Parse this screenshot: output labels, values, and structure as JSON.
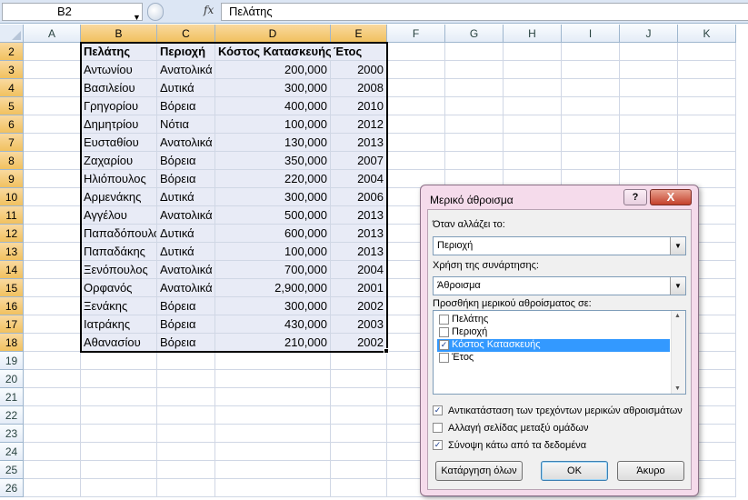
{
  "formula_bar": {
    "name_box": "B2",
    "fx_label": "fx",
    "formula_value": "Πελάτης"
  },
  "sheet": {
    "columns": [
      "A",
      "B",
      "C",
      "D",
      "E",
      "F",
      "G",
      "H",
      "I",
      "J",
      "K"
    ],
    "selected_columns": [
      "B",
      "C",
      "D",
      "E"
    ],
    "rows": [
      2,
      3,
      4,
      5,
      6,
      7,
      8,
      9,
      10,
      11,
      12,
      13,
      14,
      15,
      16,
      17,
      18,
      19,
      20,
      21,
      22,
      23,
      24,
      25,
      26
    ],
    "selected_rows": [
      2,
      3,
      4,
      5,
      6,
      7,
      8,
      9,
      10,
      11,
      12,
      13,
      14,
      15,
      16,
      17,
      18
    ],
    "table_headers": [
      "Πελάτης",
      "Περιοχή",
      "Κόστος Κατασκευής",
      "Έτος"
    ],
    "table_rows": [
      [
        "Αντωνίου",
        "Ανατολικά",
        "200,000",
        "2000"
      ],
      [
        "Βασιλείου",
        "Δυτικά",
        "300,000",
        "2008"
      ],
      [
        "Γρηγορίου",
        "Βόρεια",
        "400,000",
        "2010"
      ],
      [
        "Δημητρίου",
        "Νότια",
        "100,000",
        "2012"
      ],
      [
        "Ευσταθίου",
        "Ανατολικά",
        "130,000",
        "2013"
      ],
      [
        "Ζαχαρίου",
        "Βόρεια",
        "350,000",
        "2007"
      ],
      [
        "Ηλιόπουλος",
        "Βόρεια",
        "220,000",
        "2004"
      ],
      [
        "Αρμενάκης",
        "Δυτικά",
        "300,000",
        "2006"
      ],
      [
        "Αγγέλου",
        "Ανατολικά",
        "500,000",
        "2013"
      ],
      [
        "Παπαδόπουλος",
        "Δυτικά",
        "600,000",
        "2013"
      ],
      [
        "Παπαδάκης",
        "Δυτικά",
        "100,000",
        "2013"
      ],
      [
        "Ξενόπουλος",
        "Ανατολικά",
        "700,000",
        "2004"
      ],
      [
        "Ορφανός",
        "Ανατολικά",
        "2,900,000",
        "2001"
      ],
      [
        "Ξενάκης",
        "Βόρεια",
        "300,000",
        "2002"
      ],
      [
        "Ιατράκης",
        "Βόρεια",
        "430,000",
        "2003"
      ],
      [
        "Αθανασίου",
        "Βόρεια",
        "210,000",
        "2002"
      ]
    ]
  },
  "dialog": {
    "title": "Μερικό άθροισμα",
    "help_label": "?",
    "close_label": "X",
    "change_label": "Όταν αλλάζει το:",
    "change_value": "Περιοχή",
    "function_label": "Χρήση της συνάρτησης:",
    "function_value": "Άθροισμα",
    "add_label": "Προσθήκη μερικού αθροίσματος σε:",
    "fields": [
      {
        "label": "Πελάτης",
        "checked": false,
        "selected": false
      },
      {
        "label": "Περιοχή",
        "checked": false,
        "selected": false
      },
      {
        "label": "Κόστος Κατασκευής",
        "checked": true,
        "selected": true
      },
      {
        "label": "Έτος",
        "checked": false,
        "selected": false
      }
    ],
    "options": [
      {
        "label": "Αντικατάσταση των τρεχόντων μερικών αθροισμάτων",
        "checked": true
      },
      {
        "label": "Αλλαγή σελίδας μεταξύ ομάδων",
        "checked": false
      },
      {
        "label": "Σύνοψη κάτω από τα δεδομένα",
        "checked": true
      }
    ],
    "remove_all_label": "Κατάργηση όλων",
    "ok_label": "OK",
    "cancel_label": "Άκυρο"
  },
  "colors": {
    "selection_fill": "#e8ebf6",
    "header_selected": "#f1c15f",
    "dialog_frame": "#f5dbeb",
    "list_highlight": "#3399ff"
  }
}
